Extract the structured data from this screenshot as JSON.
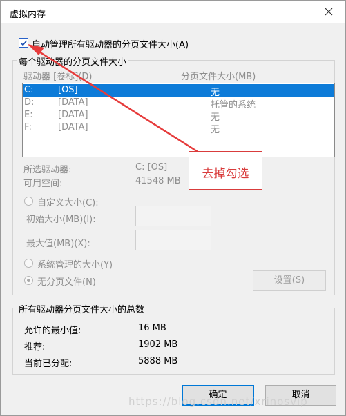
{
  "window": {
    "title": "虚拟内存"
  },
  "auto_manage": {
    "label": "自动管理所有驱动器的分页文件大小(A)",
    "checked": true
  },
  "per_drive": {
    "group_label": "每个驱动器的分页文件大小",
    "col_drive": "驱动器 [卷标](D)",
    "col_size": "分页文件大小(MB)",
    "rows": [
      {
        "drive": "C:",
        "label": "[OS]",
        "size": "无",
        "selected": true
      },
      {
        "drive": "D:",
        "label": "[DATA]",
        "size": "托管的系统"
      },
      {
        "drive": "E:",
        "label": "[DATA]",
        "size": "无"
      },
      {
        "drive": "F:",
        "label": "[DATA]",
        "size": "无"
      }
    ],
    "selected_drive_label": "所选驱动器:",
    "selected_drive_value": "C:  [OS]",
    "free_space_label": "可用空间:",
    "free_space_value": "41548 MB",
    "custom_size_label": "自定义大小(C):",
    "initial_size_label": "初始大小(MB)(I):",
    "max_size_label": "最大值(MB)(X):",
    "system_managed_label": "系统管理的大小(Y)",
    "no_paging_label": "无分页文件(N)",
    "set_button": "设置(S)"
  },
  "totals": {
    "group_label": "所有驱动器分页文件大小的总数",
    "min_label": "允许的最小值:",
    "min_value": "16 MB",
    "recommended_label": "推荐:",
    "recommended_value": "1902 MB",
    "current_label": "当前已分配:",
    "current_value": "5888 MB"
  },
  "buttons": {
    "ok": "确定",
    "cancel": "取消"
  },
  "annotation": {
    "text": "去掉勾选",
    "color": "#d93c3c"
  },
  "watermark": "https://blog.csdn.net/xrinosvip",
  "colors": {
    "selection": "#0d7bd8",
    "accent": "#0078d7"
  }
}
